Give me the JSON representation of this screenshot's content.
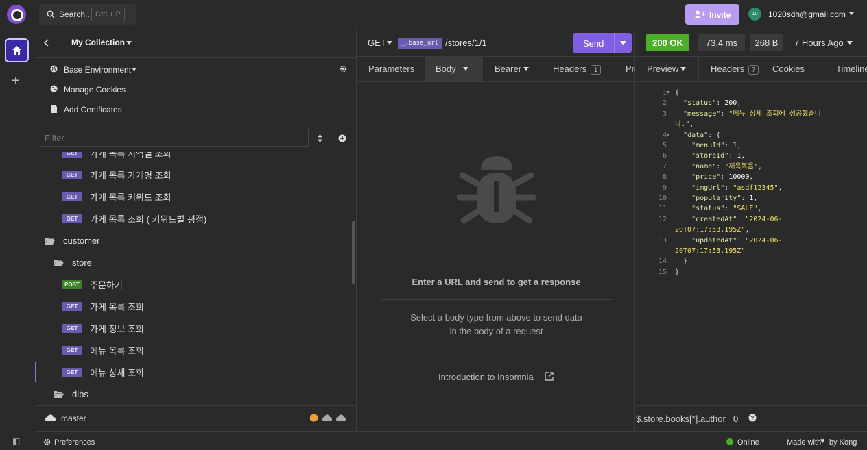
{
  "topbar": {
    "search_label": "Search..",
    "search_shortcut": "Ctrl + P",
    "invite_label": "Invite",
    "avatar_initials": "10",
    "user_email": "1020sdh@gmail.com"
  },
  "sidebar": {
    "collection_title": "My Collection",
    "base_environment": "Base Environment",
    "manage_cookies": "Manage Cookies",
    "add_certificates": "Add Certificates",
    "filter_placeholder": "Filter",
    "tree": [
      {
        "method": "GET",
        "label": "가게 목록 지역별 조회"
      },
      {
        "method": "GET",
        "label": "가게 목록 가게명 조회"
      },
      {
        "method": "GET",
        "label": "가게 목록 키워드 조회"
      },
      {
        "method": "GET",
        "label": "가게 목록 조회 ( 키워드별 평점)"
      },
      {
        "folder": true,
        "label": "customer"
      },
      {
        "folder": true,
        "label": "store"
      },
      {
        "method": "POST",
        "label": "주문하기"
      },
      {
        "method": "GET",
        "label": "가게 목록 조회"
      },
      {
        "method": "GET",
        "label": "가게 정보 조회"
      },
      {
        "method": "GET",
        "label": "메뉴 목록 조회"
      },
      {
        "method": "GET",
        "label": "메뉴 상세 조회"
      },
      {
        "folder": true,
        "label": "dibs"
      }
    ],
    "branch": "master"
  },
  "request": {
    "method": "GET",
    "base_url_token": "_.base_url",
    "path": "/stores/1/1",
    "send_label": "Send",
    "tabs": {
      "parameters": "Parameters",
      "body": "Body",
      "bearer": "Bearer",
      "headers": "Headers",
      "headers_count": "1",
      "pre": "Pre"
    },
    "empty_title": "Enter a URL and send to get a response",
    "empty_line1": "Select a body type from above to send data",
    "empty_line2": "in the body of a request",
    "intro_link": "Introduction to Insomnia"
  },
  "response": {
    "status": "200 OK",
    "time": "73.4 ms",
    "size": "268 B",
    "ago": "7 Hours Ago",
    "tabs": {
      "preview": "Preview",
      "headers": "Headers",
      "headers_count": "7",
      "cookies": "Cookies",
      "timeline": "Timeline"
    },
    "filter_expr": "$.store.books[*].author",
    "filter_count": "0",
    "lines": [
      "1",
      "2",
      "3",
      "",
      "4",
      "5",
      "6",
      "7",
      "8",
      "9",
      "10",
      "11",
      "12",
      "",
      "13",
      "",
      "14",
      "15"
    ]
  },
  "statusbar": {
    "preferences": "Preferences",
    "online": "Online",
    "made_with": "Made with",
    "by_kong": "by Kong"
  },
  "colors": {
    "accent": "#7d4dd6",
    "send": "#7f5fe0",
    "ok_green": "#4caf2a",
    "get_badge": "#6a5bb0",
    "post_badge": "#3f7f2a"
  }
}
